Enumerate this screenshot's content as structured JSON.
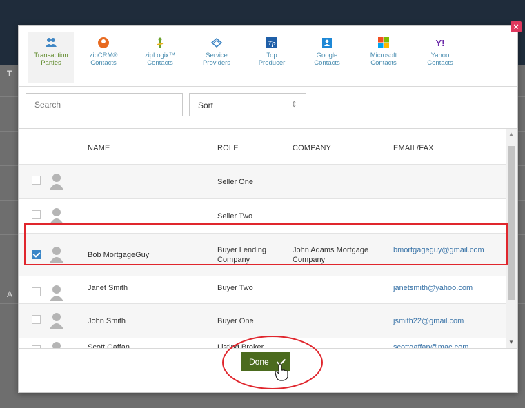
{
  "tabs": [
    {
      "label_line1": "Transaction",
      "label_line2": "Parties",
      "icon": "people-icon",
      "color": "#3f86c4",
      "active": true
    },
    {
      "label_line1": "zipCRM®",
      "label_line2": "Contacts",
      "icon": "zipcrm-icon",
      "color": "#e86a1f",
      "active": false
    },
    {
      "label_line1": "zipLogix™",
      "label_line2": "Contacts",
      "icon": "ziplogix-icon",
      "color": "#6aa22b",
      "active": false
    },
    {
      "label_line1": "Service",
      "label_line2": "Providers",
      "icon": "handshake-icon",
      "color": "#3f86c4",
      "active": false
    },
    {
      "label_line1": "Top",
      "label_line2": "Producer",
      "icon": "top-producer-icon",
      "color": "#1f5fa8",
      "active": false
    },
    {
      "label_line1": "Google",
      "label_line2": "Contacts",
      "icon": "google-contacts-icon",
      "color": "#1e88d6",
      "active": false
    },
    {
      "label_line1": "Microsoft",
      "label_line2": "Contacts",
      "icon": "microsoft-icon",
      "color": "#f25022",
      "active": false
    },
    {
      "label_line1": "Yahoo",
      "label_line2": "Contacts",
      "icon": "yahoo-icon",
      "color": "#6b2aa8",
      "active": false
    }
  ],
  "search": {
    "placeholder": "Search",
    "value": ""
  },
  "sort": {
    "label": "Sort",
    "arrow": "⇕"
  },
  "table": {
    "headers": {
      "name": "NAME",
      "role": "ROLE",
      "company": "COMPANY",
      "email": "EMAIL/FAX"
    },
    "rows": [
      {
        "name": "",
        "role": "Seller One",
        "company": "",
        "email": "",
        "checked": false
      },
      {
        "name": "",
        "role": "Seller Two",
        "company": "",
        "email": "",
        "checked": false
      },
      {
        "name": "Bob MortgageGuy",
        "role": "Buyer Lending Company",
        "company": "John Adams Mortgage Company",
        "email": "bmortgageguy@gmail.com",
        "checked": true
      },
      {
        "name": "Janet Smith",
        "role": "Buyer Two",
        "company": "",
        "email": "janetsmith@yahoo.com",
        "checked": false
      },
      {
        "name": "John Smith",
        "role": "Buyer One",
        "company": "",
        "email": "jsmith22@gmail.com",
        "checked": false
      },
      {
        "name": "Scott Gaffan",
        "role": "Listing Broker",
        "company": "",
        "email": "scottgaffan@mac.com",
        "checked": false
      }
    ]
  },
  "footer": {
    "done_label": "Done"
  },
  "close_label": "×",
  "background": {
    "tab_fragment": "T",
    "row_fragment": "A"
  },
  "colors": {
    "accent": "#4b6b1e",
    "link": "#3a74a8",
    "highlight": "#e0262d",
    "checkbox": "#3a86c8"
  }
}
